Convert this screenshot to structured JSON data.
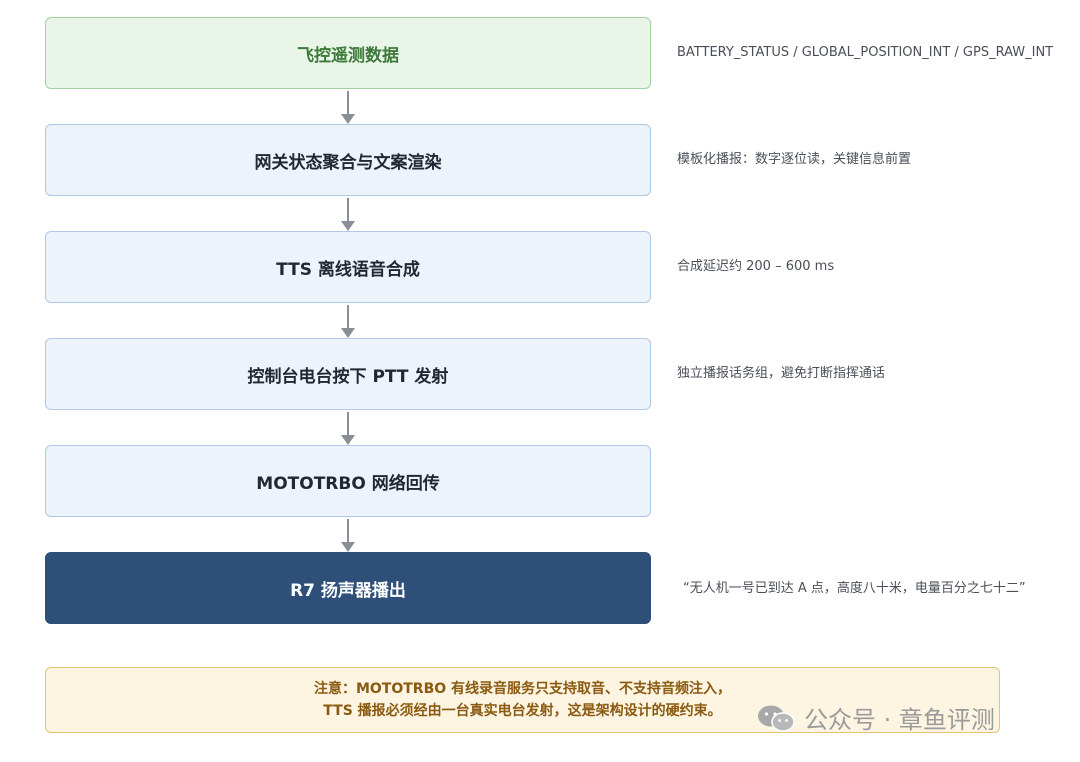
{
  "stages": [
    {
      "label": "飞控遥测数据",
      "note": "BATTERY_STATUS / GLOBAL_POSITION_INT / GPS_RAW_INT"
    },
    {
      "label": "网关状态聚合与文案渲染",
      "note": "模板化播报：数字逐位读，关键信息前置"
    },
    {
      "label": "TTS 离线语音合成",
      "note": "合成延迟约 200 – 600 ms"
    },
    {
      "label": "控制台电台按下 PTT 发射",
      "note": "独立播报话务组，避免打断指挥通话"
    },
    {
      "label": "MOTOTRBO 网络回传",
      "note": ""
    },
    {
      "label": "R7 扬声器播出",
      "note": "“无人机一号已到达 A 点，高度八十米，电量百分之七十二”"
    }
  ],
  "warning": {
    "line1": "注意：MOTOTRBO 有线录音服务只支持取音、不支持音频注入，",
    "line2": "TTS 播报必须经由一台真实电台发射，这是架构设计的硬约束。"
  },
  "watermark": {
    "text": "公众号 · 章鱼评测",
    "icon": "wechat-icon"
  },
  "colors": {
    "green_fill": "#eaf5ea",
    "blue_fill": "#edf3fb",
    "dark_fill": "#2d4f78",
    "warning_fill": "#fdf4e2",
    "arrow": "#8a8f97"
  }
}
